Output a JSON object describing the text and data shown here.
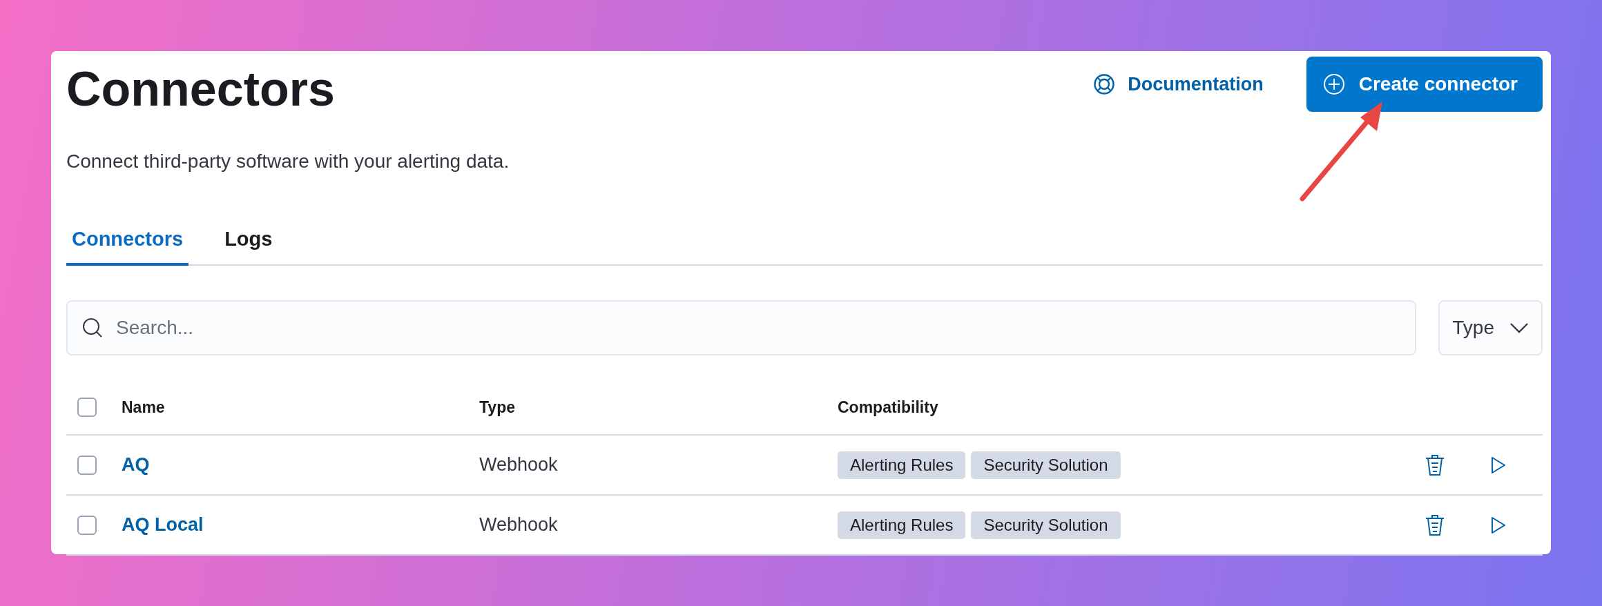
{
  "header": {
    "title": "Connectors",
    "documentation_link": "Documentation",
    "create_button": "Create connector"
  },
  "description": "Connect third-party software with your alerting data.",
  "tabs": [
    {
      "label": "Connectors",
      "selected": true
    },
    {
      "label": "Logs",
      "selected": false
    }
  ],
  "search": {
    "placeholder": "Search..."
  },
  "type_filter": {
    "label": "Type"
  },
  "table": {
    "select_all": {
      "checked": false
    },
    "columns": [
      "Name",
      "Type",
      "Compatibility"
    ],
    "rows": [
      {
        "checked": false,
        "name": "AQ",
        "type": "Webhook",
        "compatibility": [
          "Alerting Rules",
          "Security Solution"
        ]
      },
      {
        "checked": false,
        "name": "AQ Local",
        "type": "Webhook",
        "compatibility": [
          "Alerting Rules",
          "Security Solution"
        ]
      }
    ]
  }
}
